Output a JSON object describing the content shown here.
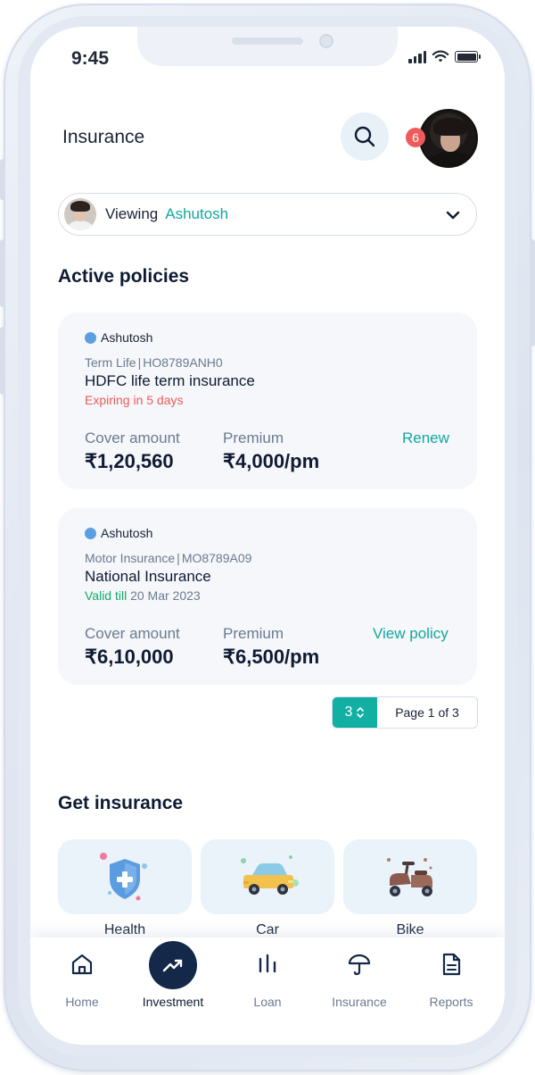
{
  "status_bar": {
    "time": "9:45"
  },
  "header": {
    "title": "Insurance",
    "notification_count": "6"
  },
  "viewing": {
    "label": "Viewing",
    "name": "Ashutosh"
  },
  "active_policies": {
    "title": "Active policies",
    "policies": [
      {
        "owner": "Ashutosh",
        "type": "Term Life",
        "policy_no": "HO8789ANH0",
        "name": "HDFC life term insurance",
        "status_prefix": "Expiring in 5 days",
        "status_suffix": "",
        "cover_label": "Cover amount",
        "cover_value": "₹1,20,560",
        "premium_label": "Premium",
        "premium_value": "₹4,000/pm",
        "action": "Renew"
      },
      {
        "owner": "Ashutosh",
        "type": "Motor Insurance",
        "policy_no": "MO8789A09",
        "name": "National Insurance",
        "status_prefix": "Valid till",
        "status_suffix": " 20 Mar 2023",
        "cover_label": "Cover amount",
        "cover_value": "₹6,10,000",
        "premium_label": "Premium",
        "premium_value": "₹6,500/pm",
        "action": "View policy"
      }
    ],
    "pagination": {
      "page_size": "3",
      "page_text": "Page 1 of 3"
    }
  },
  "get_insurance": {
    "title": "Get insurance",
    "items": [
      {
        "label": "Health",
        "icon": "health-shield-icon"
      },
      {
        "label": "Car",
        "icon": "car-icon"
      },
      {
        "label": "Bike",
        "icon": "scooter-icon"
      }
    ]
  },
  "bottom_nav": {
    "items": [
      {
        "label": "Home",
        "icon": "home-icon"
      },
      {
        "label": "Investment",
        "icon": "trending-up-icon",
        "active": true
      },
      {
        "label": "Loan",
        "icon": "bar-chart-icon"
      },
      {
        "label": "Insurance",
        "icon": "umbrella-icon"
      },
      {
        "label": "Reports",
        "icon": "document-icon"
      }
    ]
  },
  "colors": {
    "accent": "#12a89b",
    "nav_active": "#14294a",
    "danger": "#ee5a5a",
    "success": "#15a86a",
    "card_bg": "#f5f7fa"
  }
}
